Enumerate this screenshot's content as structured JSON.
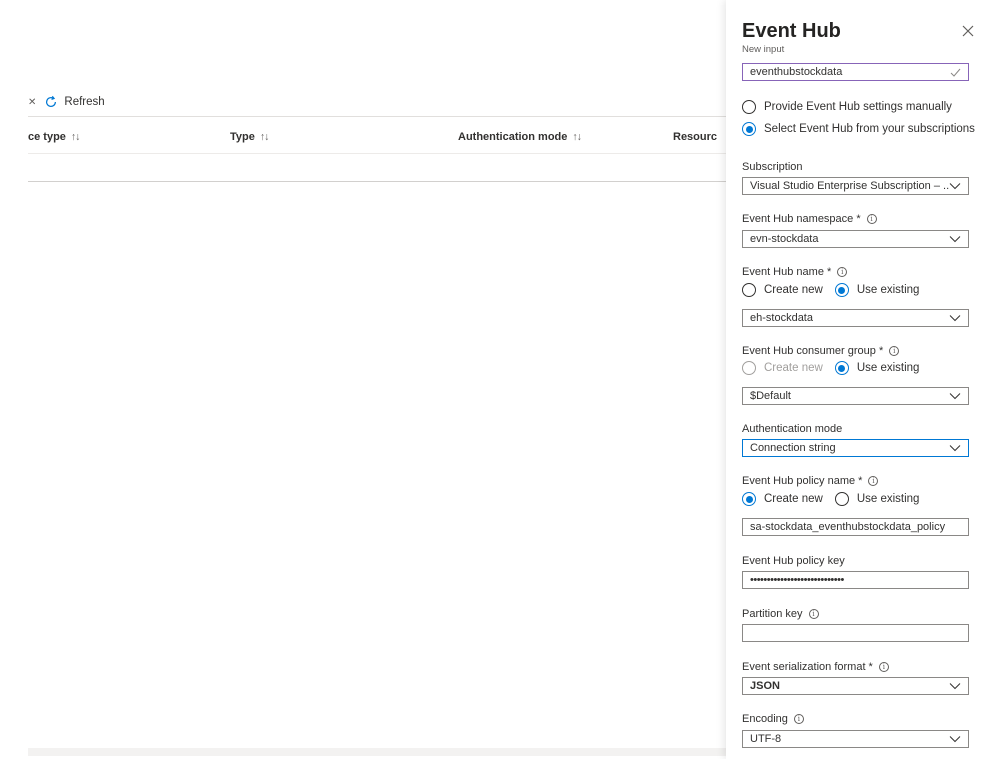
{
  "toolbar": {
    "refresh_label": "Refresh"
  },
  "table": {
    "columns": [
      {
        "label": "ce type",
        "sort": "↑↓"
      },
      {
        "label": "Type",
        "sort": "↑↓"
      },
      {
        "label": "Authentication mode",
        "sort": "↑↓"
      },
      {
        "label": "Resourc"
      }
    ]
  },
  "panel": {
    "title": "Event Hub",
    "subtitle": "New input",
    "input_alias": "eventhubstockdata",
    "settings_options": {
      "manual": "Provide Event Hub settings manually",
      "select": "Select Event Hub from your subscriptions",
      "selected": "select"
    },
    "subscription": {
      "label": "Subscription",
      "value": "Visual Studio Enterprise Subscription – ..."
    },
    "namespace": {
      "label": "Event Hub namespace *",
      "value": "evn-stockdata"
    },
    "hub_name": {
      "label": "Event Hub name *",
      "create_new": "Create new",
      "use_existing": "Use existing",
      "selected": "use_existing",
      "value": "eh-stockdata"
    },
    "consumer_group": {
      "label": "Event Hub consumer group *",
      "create_new": "Create new",
      "use_existing": "Use existing",
      "selected": "use_existing",
      "value": "$Default"
    },
    "auth_mode": {
      "label": "Authentication mode",
      "value": "Connection string"
    },
    "policy_name": {
      "label": "Event Hub policy name *",
      "create_new": "Create new",
      "use_existing": "Use existing",
      "selected": "create_new",
      "value": "sa-stockdata_eventhubstockdata_policy"
    },
    "policy_key": {
      "label": "Event Hub policy key",
      "value": "••••••••••••••••••••••••••••"
    },
    "partition_key": {
      "label": "Partition key",
      "value": ""
    },
    "serialization": {
      "label": "Event serialization format *",
      "value": "JSON"
    },
    "encoding": {
      "label": "Encoding",
      "value": "UTF-8"
    }
  }
}
